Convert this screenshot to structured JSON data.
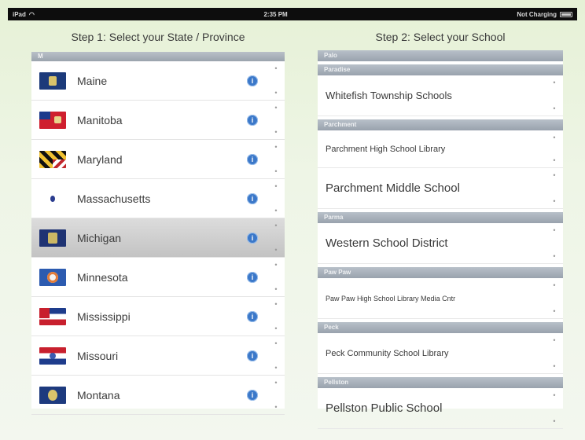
{
  "status_bar": {
    "left": "iPad",
    "center": "2:35 PM",
    "right": "Not Charging"
  },
  "left_panel": {
    "title": "Step 1: Select your State / Province",
    "section_label": "M",
    "states": [
      {
        "name": "Maine",
        "flag": "maine-flag-icon",
        "selected": false
      },
      {
        "name": "Manitoba",
        "flag": "manitoba-flag-icon",
        "selected": false
      },
      {
        "name": "Maryland",
        "flag": "maryland-flag-icon",
        "selected": false
      },
      {
        "name": "Massachusetts",
        "flag": "massachusetts-flag-icon",
        "selected": false
      },
      {
        "name": "Michigan",
        "flag": "michigan-flag-icon",
        "selected": true
      },
      {
        "name": "Minnesota",
        "flag": "minnesota-flag-icon",
        "selected": false
      },
      {
        "name": "Mississippi",
        "flag": "mississippi-flag-icon",
        "selected": false
      },
      {
        "name": "Missouri",
        "flag": "missouri-flag-icon",
        "selected": false
      },
      {
        "name": "Montana",
        "flag": "montana-flag-icon",
        "selected": false
      }
    ],
    "info_glyph": "i"
  },
  "right_panel": {
    "title": "Step 2: Select your School",
    "groups": [
      {
        "header": "Palo",
        "schools": []
      },
      {
        "header": "Paradise",
        "schools": [
          "Whitefish Township Schools"
        ]
      },
      {
        "header": "Parchment",
        "schools": [
          "Parchment High School Library",
          "Parchment Middle School"
        ]
      },
      {
        "header": "Parma",
        "schools": [
          "Western School District"
        ]
      },
      {
        "header": "Paw Paw",
        "schools": [
          "Paw Paw High School Library Media Cntr"
        ]
      },
      {
        "header": "Peck",
        "schools": [
          "Peck Community School Library"
        ]
      },
      {
        "header": "Pellston",
        "schools": [
          "Pellston Public School"
        ]
      }
    ]
  },
  "colors": {
    "selected_row": "#c9c9c9",
    "info_button": "#3b78c9",
    "section_header": "#a5adb6",
    "background": "#e6f1d6"
  }
}
